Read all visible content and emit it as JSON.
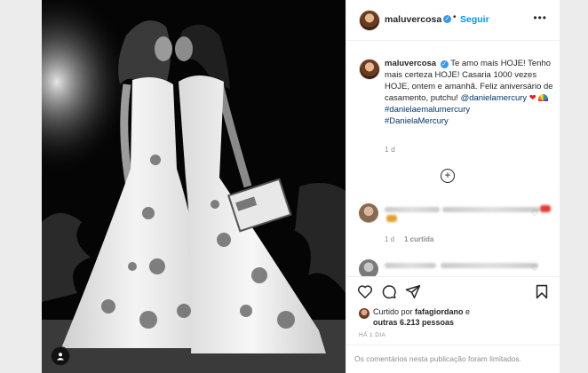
{
  "post": {
    "username": "maluvercosa",
    "follow_label": "Seguir",
    "separator": "•",
    "more_label": "•••"
  },
  "caption": {
    "username": "maluvercosa",
    "text_1": "Te amo mais HOJE! Tenho mais certeza HOJE! Casaria 1000 vezes HOJE, ontem e amanhã. Feliz aniversário de casamento, putchu! ",
    "mention": "@danielamercury",
    "hashtag_1": "#danielaemalumercury",
    "hashtag_2": "#DanielaMercury",
    "time": "1 d",
    "emoji_heart": "❤",
    "emoji_rainbow": "rainbow"
  },
  "comments": [
    {
      "time": "1 d",
      "replies": "1 curtida",
      "heart": "♡"
    },
    {
      "heart": "♡"
    }
  ],
  "load_more": "+",
  "actions": {
    "icons": [
      "heart-icon",
      "comment-icon",
      "share-icon",
      "bookmark-icon"
    ],
    "liked_prefix": "Curtido por ",
    "liked_user": "fafagiordano",
    "liked_mid": " e ",
    "liked_others": "outras 6.213 pessoas",
    "post_time": "HÁ 1 DIA",
    "comments_limited": "Os comentários nesta publicação foram limitados."
  },
  "colors": {
    "link": "#00376b",
    "follow": "#0095f6",
    "muted": "#8e8e8e",
    "verified": "#3897f0"
  }
}
